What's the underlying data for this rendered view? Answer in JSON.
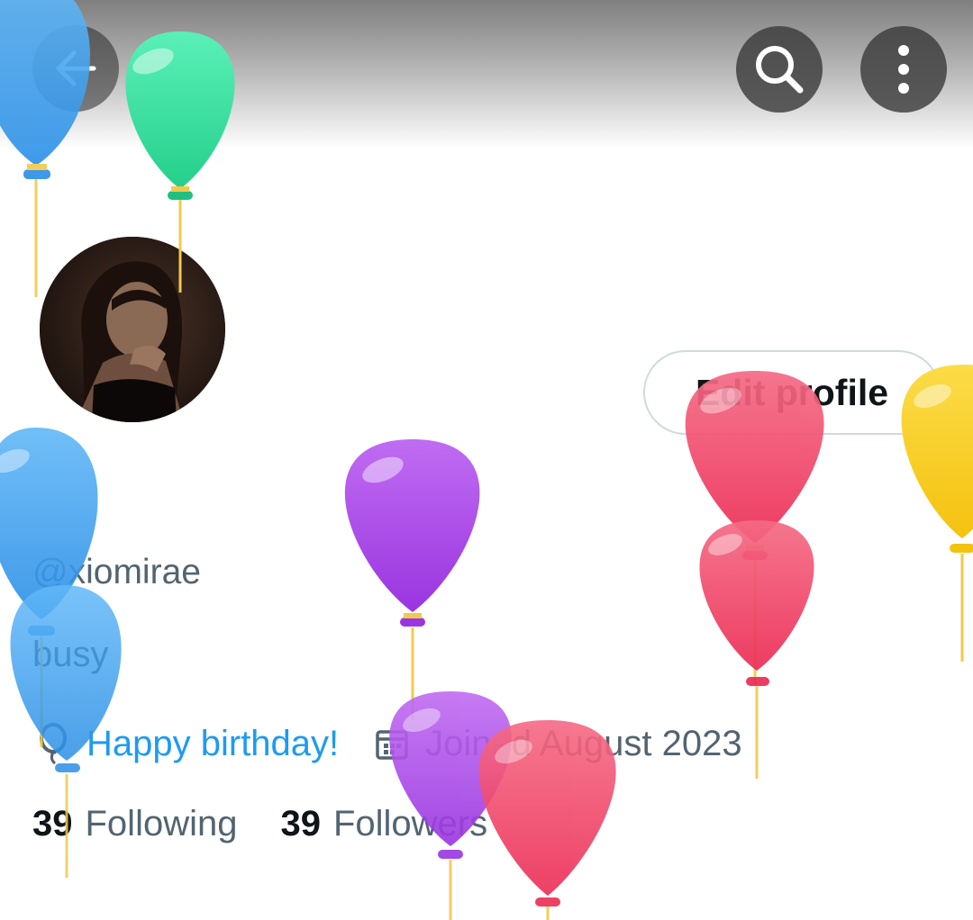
{
  "header": {
    "back_icon": "arrow-left-icon",
    "search_icon": "search-icon",
    "more_icon": "more-vertical-icon"
  },
  "profile": {
    "edit_label": "Edit profile",
    "handle": "@xiomirae",
    "bio": "busy",
    "birthday": "Happy birthday!",
    "joined": "Joined August 2023",
    "following_count": "39",
    "following_label": "Following",
    "followers_count": "39",
    "followers_label": "Followers"
  },
  "colors": {
    "accent": "#1d9bf0",
    "text_primary": "#0f1419",
    "text_secondary": "#536471",
    "balloon_blue": "#4aa8f0",
    "balloon_green": "#3fe0a3",
    "balloon_purple": "#b055ea",
    "balloon_red": "#f2506f",
    "balloon_yellow": "#f8d02c"
  }
}
